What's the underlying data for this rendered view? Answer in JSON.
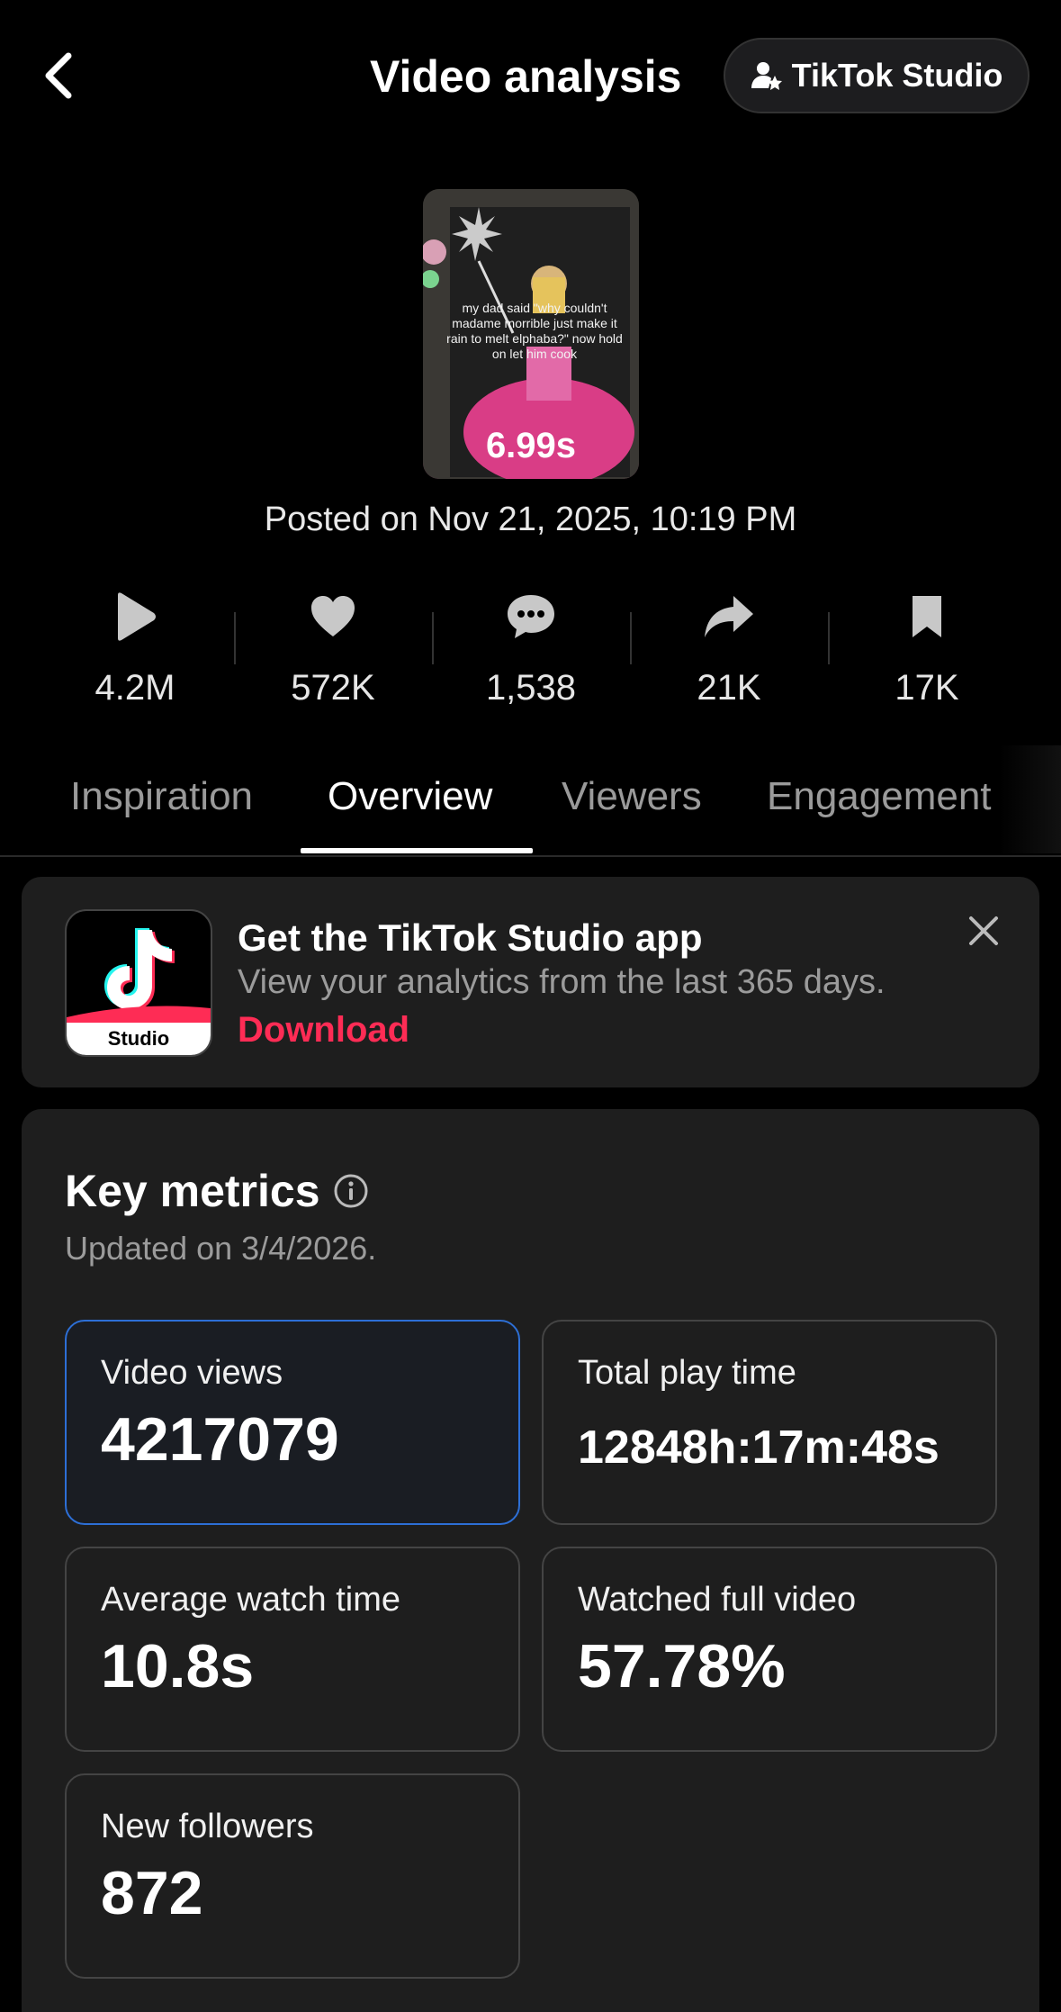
{
  "header": {
    "title": "Video analysis",
    "studio_button": "TikTok Studio"
  },
  "video": {
    "duration": "6.99s",
    "caption": "my dad said \"why couldn't madame morrible just make it rain to melt elphaba?\" now hold on let him cook",
    "posted": "Posted on Nov 21, 2025, 10:19 PM"
  },
  "stats": [
    {
      "icon": "play-icon",
      "value": "4.2M"
    },
    {
      "icon": "heart-icon",
      "value": "572K"
    },
    {
      "icon": "comment-icon",
      "value": "1,538"
    },
    {
      "icon": "share-icon",
      "value": "21K"
    },
    {
      "icon": "bookmark-icon",
      "value": "17K"
    }
  ],
  "tabs": [
    {
      "label": "Inspiration",
      "active": false
    },
    {
      "label": "Overview",
      "active": true
    },
    {
      "label": "Viewers",
      "active": false
    },
    {
      "label": "Engagement",
      "active": false
    }
  ],
  "promo": {
    "icon_label": "Studio",
    "title": "Get the TikTok Studio app",
    "subtitle": "View your analytics from the last 365 days.",
    "link": "Download"
  },
  "metrics": {
    "title": "Key metrics",
    "updated": "Updated on 3/4/2026.",
    "cards": [
      {
        "label": "Video views",
        "value": "4217079",
        "selected": true
      },
      {
        "label": "Total play time",
        "value": "12848h:17m:48s",
        "selected": false
      },
      {
        "label": "Average watch time",
        "value": "10.8s",
        "selected": false
      },
      {
        "label": "Watched full video",
        "value": "57.78%",
        "selected": false
      },
      {
        "label": "New followers",
        "value": "872",
        "selected": false
      }
    ]
  },
  "colors": {
    "accent_red": "#fe2c55",
    "selected_border": "#2d6fd6",
    "card_bg": "#1e1e1e"
  }
}
